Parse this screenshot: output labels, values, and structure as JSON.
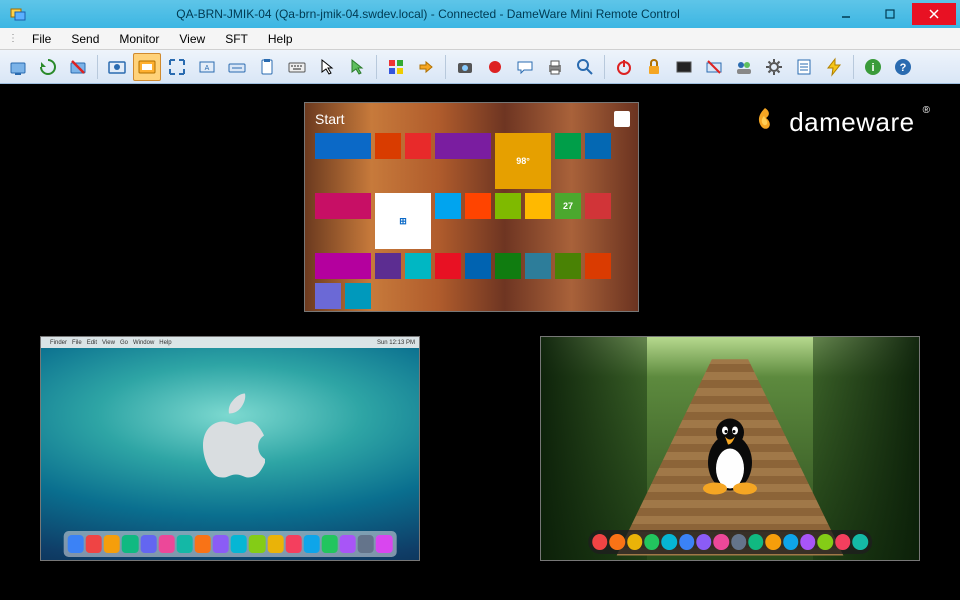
{
  "titlebar": {
    "title": "QA-BRN-JMIK-04 (Qa-brn-jmik-04.swdev.local) - Connected - DameWare Mini Remote Control"
  },
  "menubar": {
    "items": [
      "File",
      "Send",
      "Monitor",
      "View",
      "SFT",
      "Help"
    ]
  },
  "toolbar": {
    "buttons": [
      {
        "name": "connect",
        "active": false
      },
      {
        "name": "refresh",
        "active": false
      },
      {
        "name": "disconnect",
        "active": false
      },
      {
        "name": "viewonly",
        "active": false
      },
      {
        "name": "fullscreen",
        "active": true
      },
      {
        "name": "fittowindow",
        "active": false
      },
      {
        "name": "resolution",
        "active": false
      },
      {
        "name": "sendkeys",
        "active": false
      },
      {
        "name": "clipboard-in",
        "active": false
      },
      {
        "name": "keyboard",
        "active": false
      },
      {
        "name": "cursor",
        "active": false
      },
      {
        "name": "pointer",
        "active": false
      },
      {
        "name": "colorpicker",
        "active": false
      },
      {
        "name": "transfer",
        "active": false
      },
      {
        "name": "screenshot",
        "active": false
      },
      {
        "name": "record",
        "active": false
      },
      {
        "name": "chat",
        "active": false
      },
      {
        "name": "print",
        "active": false
      },
      {
        "name": "zoom",
        "active": false
      },
      {
        "name": "power",
        "active": false
      },
      {
        "name": "lock",
        "active": false
      },
      {
        "name": "blank",
        "active": false
      },
      {
        "name": "cad",
        "active": false
      },
      {
        "name": "users",
        "active": false
      },
      {
        "name": "settings",
        "active": false
      },
      {
        "name": "properties",
        "active": false
      },
      {
        "name": "quickconnect",
        "active": false
      },
      {
        "name": "about",
        "active": false
      },
      {
        "name": "help",
        "active": false
      }
    ]
  },
  "brand": {
    "name": "dameware"
  },
  "thumbnails": {
    "windows": {
      "start_label": "Start",
      "user_text": "",
      "tiles": [
        {
          "color": "#0b69c7",
          "label": "",
          "w": "w"
        },
        {
          "color": "#d93c00",
          "label": "",
          "w": ""
        },
        {
          "color": "#e82a2a",
          "label": "",
          "w": ""
        },
        {
          "color": "#7a1da0",
          "label": "",
          "w": "w"
        },
        {
          "color": "#e6a000",
          "label": "98°",
          "w": "w",
          "t": "t"
        },
        {
          "color": "#009e49",
          "label": "",
          "w": ""
        },
        {
          "color": "#0468b3",
          "label": "",
          "w": ""
        },
        {
          "color": "#c70f65",
          "label": "",
          "w": "w"
        },
        {
          "color": "#ffffff",
          "label": "⊞",
          "w": "w",
          "t": "t",
          "fg": "#0b69c7"
        },
        {
          "color": "#00a4ef",
          "label": "",
          "w": ""
        },
        {
          "color": "#ff4400",
          "label": "",
          "w": ""
        },
        {
          "color": "#7fba00",
          "label": "",
          "w": ""
        },
        {
          "color": "#ffb900",
          "label": "",
          "w": ""
        },
        {
          "color": "#4ba82e",
          "label": "27",
          "w": ""
        },
        {
          "color": "#d13438",
          "label": "",
          "w": ""
        },
        {
          "color": "#b4009e",
          "label": "",
          "w": "w"
        },
        {
          "color": "#5c2d91",
          "label": "",
          "w": ""
        },
        {
          "color": "#00b7c3",
          "label": "",
          "w": ""
        },
        {
          "color": "#e81123",
          "label": "",
          "w": ""
        },
        {
          "color": "#0063b1",
          "label": "",
          "w": ""
        },
        {
          "color": "#107c10",
          "label": "",
          "w": ""
        },
        {
          "color": "#2d7d9a",
          "label": "",
          "w": ""
        },
        {
          "color": "#498205",
          "label": "",
          "w": ""
        },
        {
          "color": "#da3b01",
          "label": "",
          "w": ""
        },
        {
          "color": "#6b69d6",
          "label": "",
          "w": ""
        },
        {
          "color": "#0099bc",
          "label": "",
          "w": ""
        }
      ]
    },
    "mac": {
      "menu_left": [
        "",
        "Finder",
        "File",
        "Edit",
        "View",
        "Go",
        "Window",
        "Help"
      ],
      "menu_right": [
        "",
        "",
        "",
        "",
        "Sun 12:13 PM"
      ],
      "dock_colors": [
        "#3b82f6",
        "#ef4444",
        "#f59e0b",
        "#10b981",
        "#6366f1",
        "#ec4899",
        "#14b8a6",
        "#f97316",
        "#8b5cf6",
        "#06b6d4",
        "#84cc16",
        "#eab308",
        "#f43f5e",
        "#0ea5e9",
        "#22c55e",
        "#a855f7",
        "#64748b",
        "#d946ef"
      ]
    },
    "linux": {
      "dock_colors": [
        "#ef4444",
        "#f97316",
        "#eab308",
        "#22c55e",
        "#06b6d4",
        "#3b82f6",
        "#8b5cf6",
        "#ec4899",
        "#64748b",
        "#10b981",
        "#f59e0b",
        "#0ea5e9",
        "#a855f7",
        "#84cc16",
        "#f43f5e",
        "#14b8a6"
      ]
    }
  }
}
